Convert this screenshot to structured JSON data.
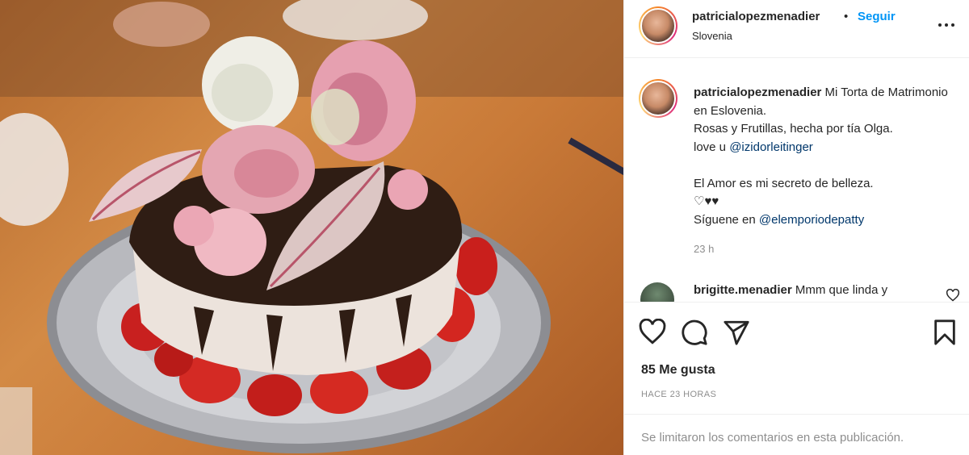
{
  "post": {
    "photo_alt": "cake with roses and strawberries",
    "username": "patricialopezmenadier",
    "separator": "•",
    "follow_label": "Seguir",
    "location": "Slovenia",
    "caption": {
      "username": "patricialopezmenadier",
      "first_line_text": " Mi Torta de Matrimonio en Eslovenia.",
      "line2": "Rosas y Frutillas, hecha por tía Olga.",
      "line3_prefix": "love u ",
      "line3_mention": "@izidorleitinger",
      "line5": "El Amor es mi secreto de belleza.",
      "line6": "♡♥♥",
      "line7_prefix": "Síguene en ",
      "line7_mention": "@elemporiodepatty",
      "time": "23 h"
    },
    "comment": {
      "username": "brigitte.menadier",
      "text": " Mmm que linda y"
    },
    "likes": "85 Me gusta",
    "time_ago": "HACE 23 HORAS",
    "comments_limited": "Se limitaron los comentarios en esta publicación."
  },
  "icons": {
    "more": "more-options-icon",
    "like": "heart-icon",
    "comment": "comment-icon",
    "share": "send-icon",
    "save": "bookmark-icon"
  },
  "colors": {
    "link_blue": "#0095f6",
    "mention": "#00376b",
    "secondary_text": "#8e8e8e",
    "border": "#efefef"
  }
}
